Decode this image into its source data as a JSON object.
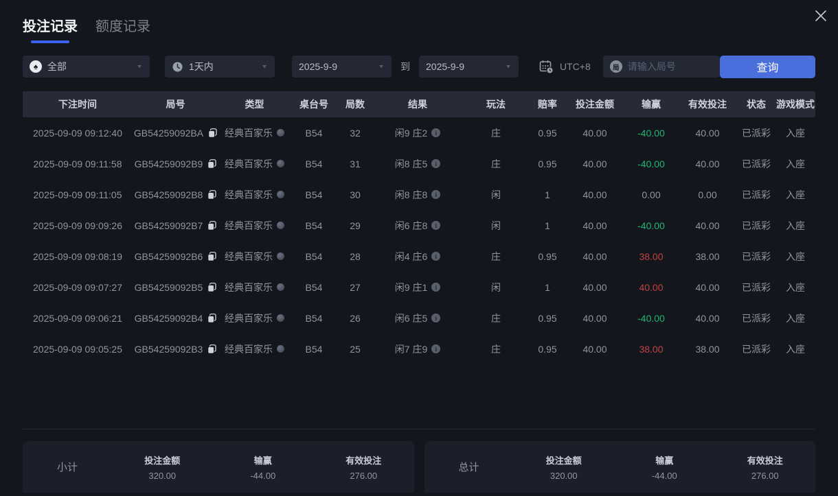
{
  "tabs": [
    {
      "label": "投注记录",
      "active": true
    },
    {
      "label": "额度记录",
      "active": false
    }
  ],
  "filters": {
    "game_type": {
      "value": "全部",
      "icon": "spade"
    },
    "time_range": {
      "value": "1天内",
      "icon": "clock"
    },
    "date_from": {
      "value": "2025-9-9"
    },
    "to_label": "到",
    "date_to": {
      "value": "2025-9-9"
    },
    "timezone": "UTC+8",
    "search": {
      "placeholder": "请输入局号",
      "icon_char": "局"
    },
    "query_button": "查询"
  },
  "table": {
    "headers": [
      "下注时间",
      "局号",
      "类型",
      "桌台号",
      "局数",
      "结果",
      "玩法",
      "赔率",
      "投注金额",
      "输赢",
      "有效投注",
      "状态",
      "游戏模式"
    ],
    "rows": [
      {
        "time": "2025-09-09 09:12:40",
        "round_id": "GB54259092BA",
        "type": "经典百家乐",
        "table_no": "B54",
        "round_no": "32",
        "result": "闲9 庄2",
        "play": "庄",
        "odds": "0.95",
        "bet": "40.00",
        "win_loss": "-40.00",
        "trend": "loss",
        "valid_bet": "40.00",
        "status": "已派彩",
        "mode": "入座"
      },
      {
        "time": "2025-09-09 09:11:58",
        "round_id": "GB54259092B9",
        "type": "经典百家乐",
        "table_no": "B54",
        "round_no": "31",
        "result": "闲8 庄5",
        "play": "庄",
        "odds": "0.95",
        "bet": "40.00",
        "win_loss": "-40.00",
        "trend": "loss",
        "valid_bet": "40.00",
        "status": "已派彩",
        "mode": "入座"
      },
      {
        "time": "2025-09-09 09:11:05",
        "round_id": "GB54259092B8",
        "type": "经典百家乐",
        "table_no": "B54",
        "round_no": "30",
        "result": "闲8 庄8",
        "play": "闲",
        "odds": "1",
        "bet": "40.00",
        "win_loss": "0.00",
        "trend": "flat",
        "valid_bet": "0.00",
        "status": "已派彩",
        "mode": "入座"
      },
      {
        "time": "2025-09-09 09:09:26",
        "round_id": "GB54259092B7",
        "type": "经典百家乐",
        "table_no": "B54",
        "round_no": "29",
        "result": "闲6 庄8",
        "play": "闲",
        "odds": "1",
        "bet": "40.00",
        "win_loss": "-40.00",
        "trend": "loss",
        "valid_bet": "40.00",
        "status": "已派彩",
        "mode": "入座"
      },
      {
        "time": "2025-09-09 09:08:19",
        "round_id": "GB54259092B6",
        "type": "经典百家乐",
        "table_no": "B54",
        "round_no": "28",
        "result": "闲4 庄6",
        "play": "庄",
        "odds": "0.95",
        "bet": "40.00",
        "win_loss": "38.00",
        "trend": "win",
        "valid_bet": "38.00",
        "status": "已派彩",
        "mode": "入座"
      },
      {
        "time": "2025-09-09 09:07:27",
        "round_id": "GB54259092B5",
        "type": "经典百家乐",
        "table_no": "B54",
        "round_no": "27",
        "result": "闲9 庄1",
        "play": "闲",
        "odds": "1",
        "bet": "40.00",
        "win_loss": "40.00",
        "trend": "win",
        "valid_bet": "40.00",
        "status": "已派彩",
        "mode": "入座"
      },
      {
        "time": "2025-09-09 09:06:21",
        "round_id": "GB54259092B4",
        "type": "经典百家乐",
        "table_no": "B54",
        "round_no": "26",
        "result": "闲6 庄5",
        "play": "庄",
        "odds": "0.95",
        "bet": "40.00",
        "win_loss": "-40.00",
        "trend": "loss",
        "valid_bet": "40.00",
        "status": "已派彩",
        "mode": "入座"
      },
      {
        "time": "2025-09-09 09:05:25",
        "round_id": "GB54259092B3",
        "type": "经典百家乐",
        "table_no": "B54",
        "round_no": "25",
        "result": "闲7 庄9",
        "play": "庄",
        "odds": "0.95",
        "bet": "40.00",
        "win_loss": "38.00",
        "trend": "win",
        "valid_bet": "38.00",
        "status": "已派彩",
        "mode": "入座"
      }
    ]
  },
  "summary": {
    "subtotal": {
      "label": "小计",
      "bet_label": "投注金额",
      "bet": "320.00",
      "wl_label": "输赢",
      "win_loss": "-44.00",
      "trend": "loss",
      "valid_label": "有效投注",
      "valid": "276.00"
    },
    "total": {
      "label": "总计",
      "bet_label": "投注金额",
      "bet": "320.00",
      "wl_label": "输赢",
      "win_loss": "-44.00",
      "trend": "loss",
      "valid_label": "有效投注",
      "valid": "276.00"
    }
  },
  "colors": {
    "accent": "#4a6edc",
    "loss_green": "#21b573",
    "win_red": "#c24242"
  }
}
